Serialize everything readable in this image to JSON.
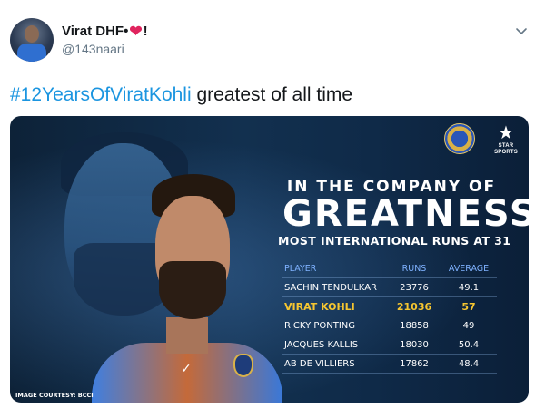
{
  "tweet": {
    "user_name": "Virat DHF",
    "name_emoji_sep": "•",
    "name_suffix": "!",
    "handle": "@143naari",
    "hashtag": "#12YearsOfViratKohli",
    "text": " greatest of all time",
    "icons": {
      "heart": "heart-icon",
      "chevron": "chevron-down-icon"
    },
    "colors": {
      "hashtag": "#1b95e0",
      "heart": "#e0245e"
    }
  },
  "graphic": {
    "star_logo_text_1": "STAR SPORTS",
    "heading_small": "IN THE COMPANY OF",
    "heading_big": "GREATNESS",
    "heading_sub": "MOST INTERNATIONAL RUNS AT 31",
    "courtesy": "IMAGE COURTESY: BCCI",
    "table": {
      "headers": [
        "PLAYER",
        "RUNS",
        "AVERAGE"
      ],
      "rows": [
        {
          "player": "SACHIN TENDULKAR",
          "runs": "23776",
          "average": "49.1"
        },
        {
          "player": "VIRAT KOHLI",
          "runs": "21036",
          "average": "57"
        },
        {
          "player": "RICKY PONTING",
          "runs": "18858",
          "average": "49"
        },
        {
          "player": "JACQUES KALLIS",
          "runs": "18030",
          "average": "50.4"
        },
        {
          "player": "AB DE VILLIERS",
          "runs": "17862",
          "average": "48.4"
        }
      ]
    },
    "colors": {
      "highlight": "#f6c630",
      "header": "#7fb2ff"
    }
  }
}
